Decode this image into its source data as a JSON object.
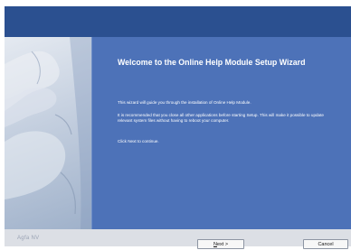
{
  "wizard": {
    "title": "Welcome to the Online Help Module Setup Wizard",
    "paragraphs": [
      "This wizard will guide you through the installation of Online Help Module.",
      "It is recommended that you close all other applications before starting Setup. This will make it possible to update relevant system files without having to reboot your computer.",
      "Click Next to continue."
    ]
  },
  "footer": {
    "brand": "Agfa NV",
    "next_label_mnemonic": "N",
    "next_label_rest": "ext >",
    "cancel_label": "Cancel"
  },
  "colors": {
    "titlebar": "#2b5090",
    "content_bg": "#4d72b8",
    "footer_bg": "#dcdfe5"
  },
  "icons": {
    "side_image": "hands-illustration"
  }
}
